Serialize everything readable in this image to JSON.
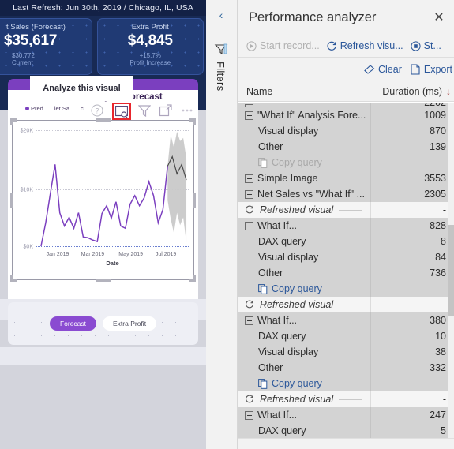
{
  "report": {
    "refresh_bar": "Last Refresh: Jun 30th, 2019 / Chicago, IL, USA",
    "kpi_cards": [
      {
        "title": "t Sales (Forecast)",
        "value": "$35,617",
        "sub1": "$30,772",
        "sub2": "Current"
      },
      {
        "title": "Extra Profit",
        "value": "$4,845",
        "sub1": "+15.7%",
        "sub2": "Profit Increase"
      }
    ],
    "visual": {
      "title": "\"What If\" Analysis Forecast",
      "legend": [
        {
          "label": "Pred",
          "color": "#7b3fbf"
        },
        {
          "label": "let Sa"
        },
        {
          "label": "c"
        }
      ],
      "icons": [
        {
          "name": "help-icon",
          "label": "?"
        },
        {
          "name": "analyze-this-visual-icon",
          "label": "Analyze this visual"
        },
        {
          "name": "filter-icon",
          "label": "Filters"
        },
        {
          "name": "focus-mode-icon",
          "label": "Focus mode"
        },
        {
          "name": "more-options-icon",
          "label": "More options"
        }
      ]
    },
    "tooltip": "Analyze this visual",
    "slicers": [
      {
        "label": "Forecast",
        "state": "active"
      },
      {
        "label": "Extra Profit",
        "state": "inactive"
      }
    ]
  },
  "chart_data": {
    "type": "line",
    "title": "\"What If\" Analysis Forecast",
    "xlabel": "Date",
    "ylabel": "",
    "ylim": [
      0,
      22000
    ],
    "yticks": [
      "$0K",
      "$10K",
      "$20K"
    ],
    "ytick_values": [
      0,
      10000,
      20000
    ],
    "xticks": [
      "Jan 2019",
      "Mar 2019",
      "May 2019",
      "Jul 2019"
    ],
    "grid": true,
    "legend_position": "top-left",
    "series": [
      {
        "name": "Predicted Net Sales",
        "color": "#7b3fbf",
        "values": [
          200,
          4700,
          9600,
          14700,
          6000,
          3600,
          5000,
          3200,
          6300,
          1900,
          1800,
          1500,
          1100,
          5800,
          7200,
          5200,
          8000,
          3600,
          3200,
          7600,
          9000,
          7200,
          8800,
          11200,
          8800,
          4000,
          6400,
          3700,
          6300,
          11000,
          9700
        ]
      },
      {
        "name": "Forecast",
        "color": "#6b6b6b",
        "values": [
          null,
          null,
          null,
          null,
          null,
          null,
          null,
          null,
          null,
          null,
          null,
          null,
          null,
          null,
          null,
          null,
          null,
          null,
          null,
          null,
          null,
          null,
          null,
          null,
          null,
          null,
          null,
          null,
          11000,
          12700,
          10300,
          12300,
          10200
        ]
      },
      {
        "name": "Confidence band",
        "color": "#c9c9c9",
        "type": "band"
      }
    ]
  },
  "filters_rail": {
    "collapse_label": "‹",
    "label": "Filters"
  },
  "perf": {
    "title": "Performance analyzer",
    "close_label": "✕",
    "toolbar": [
      {
        "label": "Start record...",
        "state": "disabled",
        "icon": "play-icon"
      },
      {
        "label": "Refresh visu...",
        "state": "enabled",
        "icon": "refresh-icon"
      },
      {
        "label": "St...",
        "state": "enabled",
        "icon": "stop-icon"
      }
    ],
    "actions": [
      {
        "label": "Clear",
        "icon": "eraser-icon"
      },
      {
        "label": "Export",
        "icon": "export-icon"
      }
    ],
    "columns": {
      "name": "Name",
      "duration": "Duration (ms)",
      "sort": "↓"
    },
    "rows": [
      {
        "kind": "clipped",
        "name": "",
        "duration": "2202",
        "style": "grp"
      },
      {
        "kind": "group",
        "name": "\"What If\" Analysis Fore...",
        "duration": "1009",
        "expanded": true
      },
      {
        "kind": "child",
        "name": "Visual display",
        "duration": "870"
      },
      {
        "kind": "child",
        "name": "Other",
        "duration": "139"
      },
      {
        "kind": "copy",
        "name": "Copy query",
        "duration": "",
        "dim": true
      },
      {
        "kind": "group",
        "name": "Simple Image",
        "duration": "3553",
        "expanded": false
      },
      {
        "kind": "group",
        "name": "Net Sales vs \"What If\" ...",
        "duration": "2305",
        "expanded": false
      },
      {
        "kind": "refresh",
        "name": "Refreshed visual",
        "duration": "-"
      },
      {
        "kind": "group",
        "name": "What If...",
        "duration": "828",
        "expanded": true
      },
      {
        "kind": "child",
        "name": "DAX query",
        "duration": "8"
      },
      {
        "kind": "child",
        "name": "Visual display",
        "duration": "84"
      },
      {
        "kind": "child",
        "name": "Other",
        "duration": "736"
      },
      {
        "kind": "copy",
        "name": "Copy query",
        "duration": "",
        "dim": false
      },
      {
        "kind": "refresh",
        "name": "Refreshed visual",
        "duration": "-"
      },
      {
        "kind": "group",
        "name": "What If...",
        "duration": "380",
        "expanded": true
      },
      {
        "kind": "child",
        "name": "DAX query",
        "duration": "10"
      },
      {
        "kind": "child",
        "name": "Visual display",
        "duration": "38"
      },
      {
        "kind": "child",
        "name": "Other",
        "duration": "332"
      },
      {
        "kind": "copy",
        "name": "Copy query",
        "duration": "",
        "dim": false
      },
      {
        "kind": "refresh",
        "name": "Refreshed visual",
        "duration": "-"
      },
      {
        "kind": "group",
        "name": "What If...",
        "duration": "247",
        "expanded": true
      },
      {
        "kind": "child",
        "name": "DAX query",
        "duration": "5"
      }
    ]
  }
}
